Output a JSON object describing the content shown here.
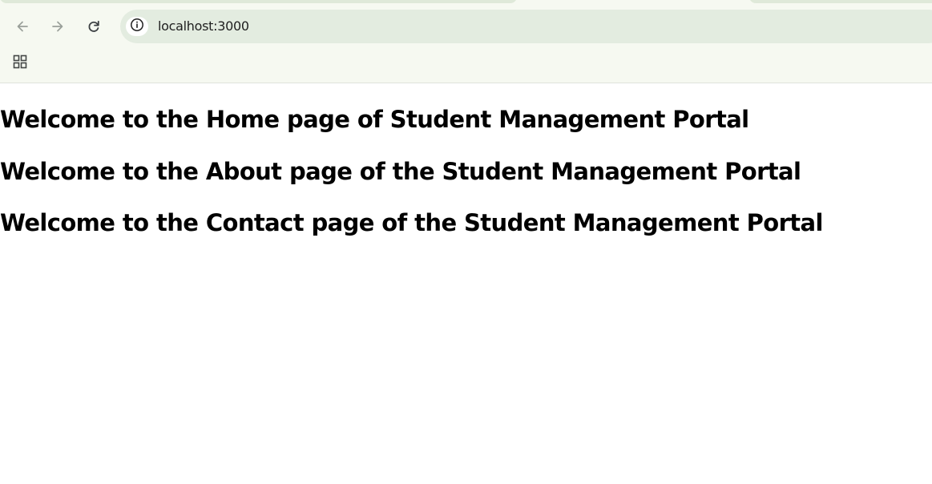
{
  "browser": {
    "url": "localhost:3000",
    "icons": {
      "back": "arrow-left-icon",
      "forward": "arrow-right-icon",
      "reload": "reload-icon",
      "site_info": "info-icon",
      "apps": "apps-grid-icon"
    }
  },
  "page": {
    "headings": [
      "Welcome to the Home page of Student Management Portal",
      "Welcome to the About page of the Student Management Portal",
      "Welcome to the Contact page of the Student Management Portal"
    ]
  }
}
